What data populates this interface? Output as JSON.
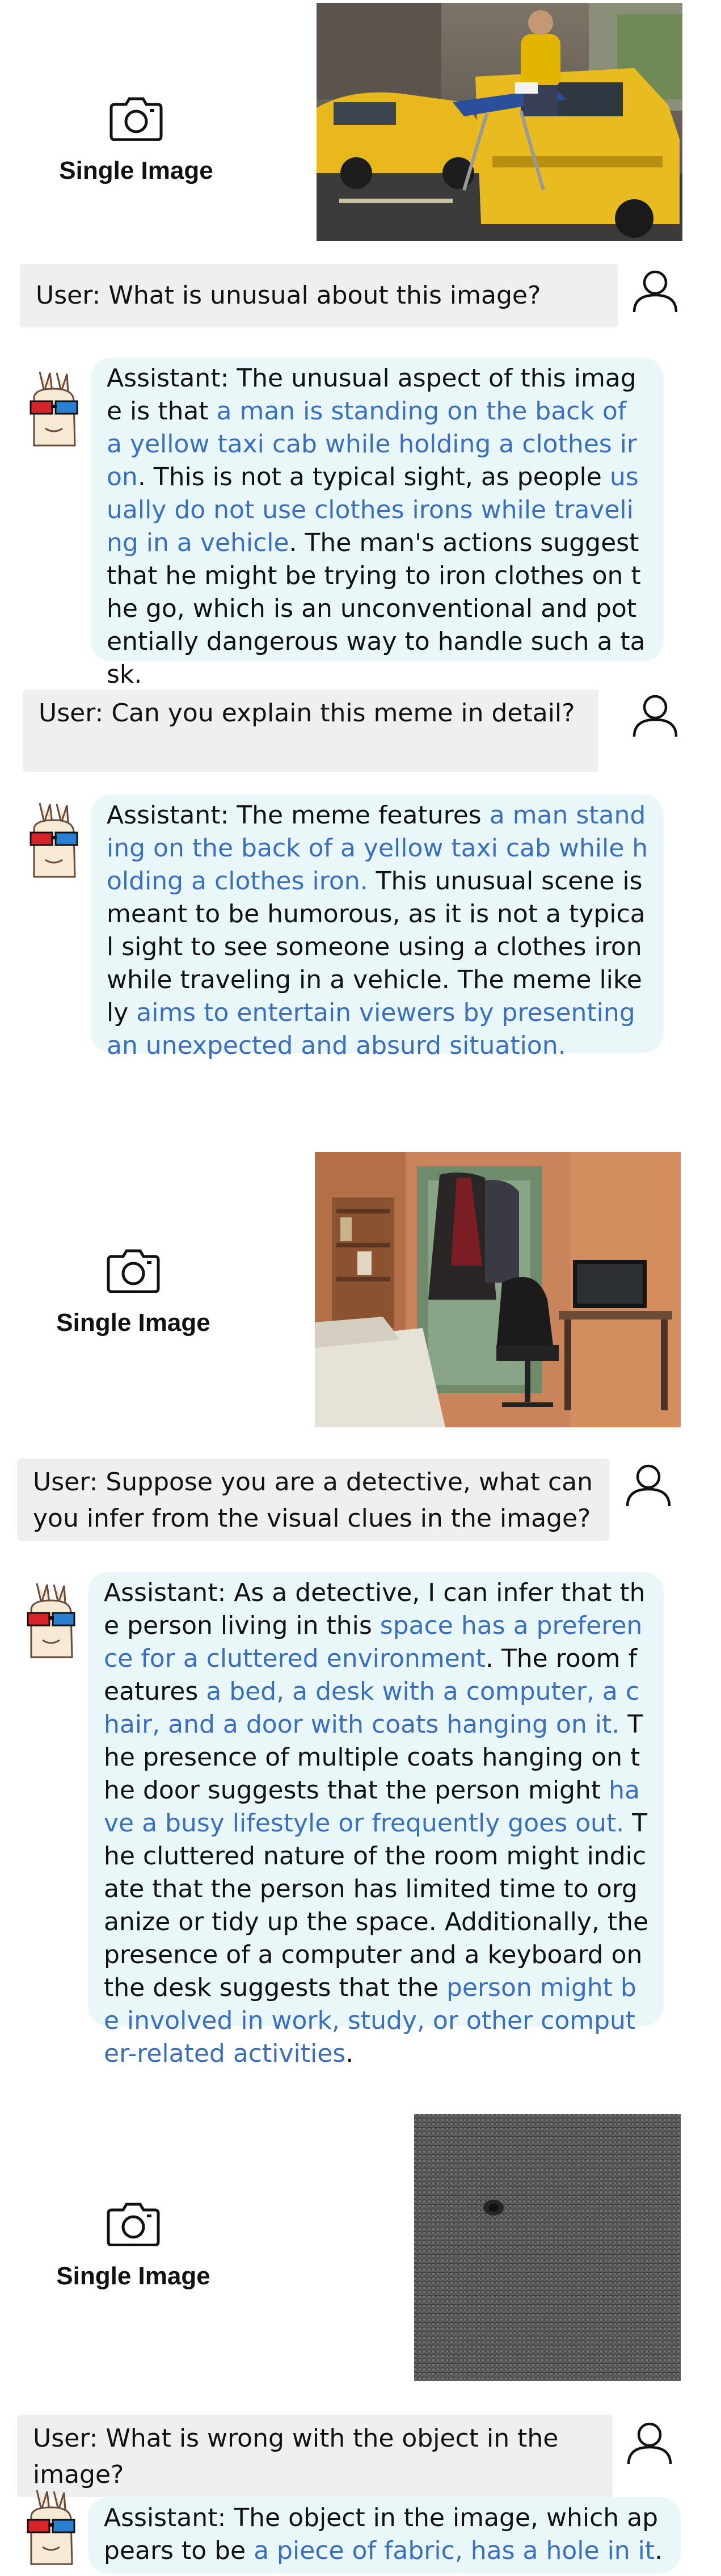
{
  "sections": [
    {
      "label": "Single Image",
      "user": {
        "prefix": "User:",
        "text": " What is unusual about this image?"
      },
      "assistant": {
        "prefix": "Assistant:",
        "segments": [
          {
            "t": " The unusual aspect of this image is that ",
            "h": false
          },
          {
            "t": "a man is standing on the back of a yellow taxi cab while holding a clothes iron",
            "h": true
          },
          {
            "t": ". This is not a typical sight, as people ",
            "h": false
          },
          {
            "t": "usually do not use clothes irons while traveling in a vehicle",
            "h": true
          },
          {
            "t": ". The man's actions suggest that he might be trying to iron clothes on the go, which is an unconventional and potentially dangerous way to handle such a task.",
            "h": false
          }
        ]
      },
      "user2": {
        "prefix": "User:",
        "text": " Can you explain this meme in detail?"
      },
      "assistant2": {
        "prefix": "Assistant:",
        "segments": [
          {
            "t": " The meme features ",
            "h": false
          },
          {
            "t": "a man standing on the back of a yellow taxi cab while holding a clothes iron.",
            "h": true
          },
          {
            "t": " This unusual scene is meant to be humorous, as it is not a typical sight to see someone using a clothes iron while traveling in a vehicle. The meme likely ",
            "h": false
          },
          {
            "t": "aims to entertain viewers by presenting an unexpected and absurd situation.",
            "h": true
          }
        ]
      }
    },
    {
      "label": "Single Image",
      "user": {
        "prefix": "User:",
        "text": " Suppose you are a detective, what can you infer from the visual clues in the image?"
      },
      "assistant": {
        "prefix": "Assistant:",
        "segments": [
          {
            "t": " As a detective, I can infer that the person living in this ",
            "h": false
          },
          {
            "t": "space has a preference for a cluttered environment",
            "h": true
          },
          {
            "t": ". The room features ",
            "h": false
          },
          {
            "t": "a bed, a desk with a computer, a chair, and a door with coats hanging on it.",
            "h": true
          },
          {
            "t": " The presence of multiple coats hanging on the door suggests that the person might ",
            "h": false
          },
          {
            "t": "have a busy lifestyle or frequently goes out.",
            "h": true
          },
          {
            "t": " The cluttered nature of the room might indicate that the person has limited time to organize or tidy up the space. Additionally, the presence of a computer and a keyboard on the desk suggests that the ",
            "h": false
          },
          {
            "t": "person might be involved in work, study, or other computer-related activities",
            "h": true
          },
          {
            "t": ".",
            "h": false
          }
        ]
      }
    },
    {
      "label": "Single Image",
      "user": {
        "prefix": "User:",
        "text": " What is wrong with the object in the image?"
      },
      "assistant": {
        "prefix": "Assistant:",
        "segments": [
          {
            "t": " The object in the image, which appears to be ",
            "h": false
          },
          {
            "t": "a piece of fabric, has a hole in it",
            "h": true
          },
          {
            "t": ".",
            "h": false
          }
        ]
      }
    }
  ],
  "icons": {
    "camera": "camera-icon",
    "user": "person-icon",
    "assistant": "llama-3d-glasses-avatar"
  },
  "colors": {
    "highlight": "#3a6fbf",
    "user_bubble": "#efefef",
    "assistant_bubble": "#eaf7f8"
  }
}
